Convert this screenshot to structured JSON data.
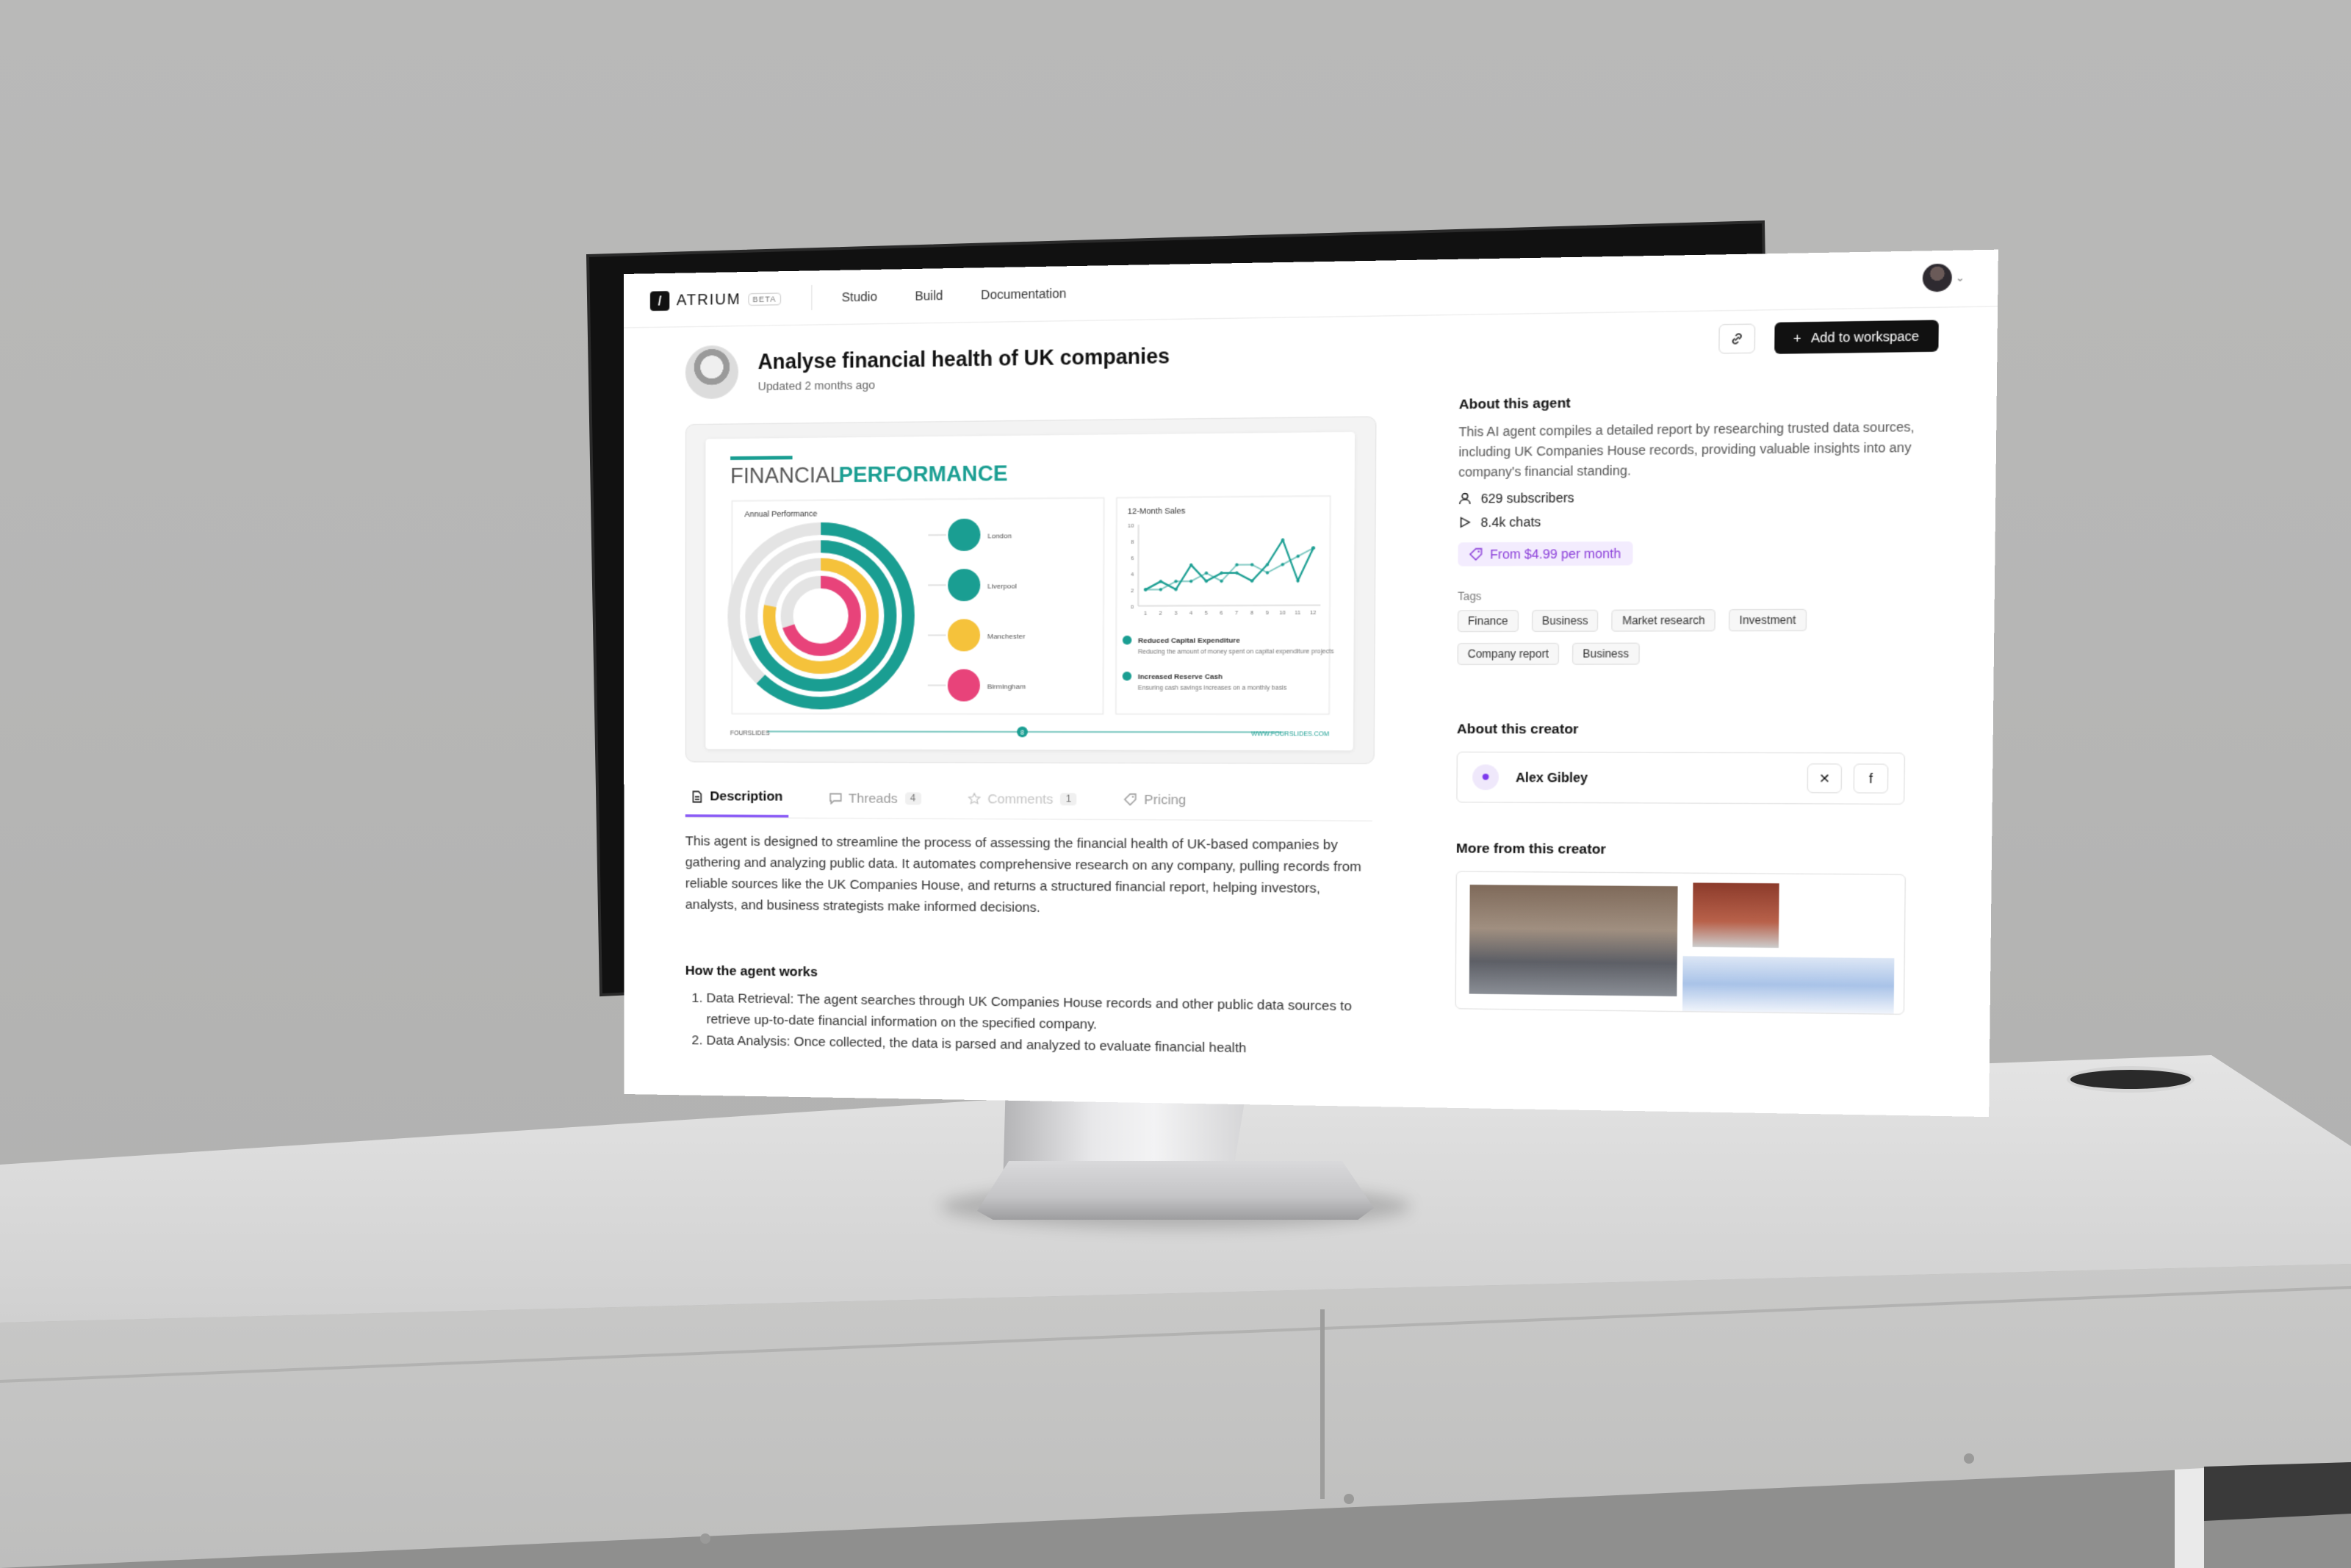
{
  "app": {
    "name": "ATRIUM",
    "badge": "BETA"
  },
  "nav": {
    "links": [
      "Studio",
      "Build",
      "Documentation"
    ]
  },
  "agent": {
    "title": "Analyse financial health of UK companies",
    "updated": "Updated 2 months ago",
    "add_button": "Add to workspace"
  },
  "infographic": {
    "title_a": "FINANCIAL",
    "title_b": "PERFORMANCE",
    "panel_left": "Annual Performance",
    "cities": [
      "London",
      "Liverpool",
      "Manchester",
      "Birmingham"
    ],
    "panel_right": "12-Month Sales",
    "y_ticks": [
      "10",
      "8",
      "6",
      "4",
      "2",
      "0"
    ],
    "x_ticks": [
      "1",
      "2",
      "3",
      "4",
      "5",
      "6",
      "7",
      "8",
      "9",
      "10",
      "11",
      "12"
    ],
    "check1_title": "Reduced Capital Expenditure",
    "check1_body": "Reducing the amount of money spent on capital expenditure projects",
    "check2_title": "Increased Reserve Cash",
    "check2_body": "Ensuring cash savings increases on a monthly basis",
    "footer_left": "FOURSLIDES",
    "footer_right": "WWW.FOURSLIDES.COM",
    "page": "8",
    "colors": {
      "teal": "#1a9e92",
      "yellow": "#f5c23b",
      "pink": "#e8437a",
      "grey": "#e4e4e4"
    },
    "sales_series": [
      {
        "name": "",
        "values": [
          2,
          3,
          2,
          5,
          3,
          4,
          4,
          3,
          5,
          8,
          3,
          7
        ]
      },
      {
        "name": "",
        "values": [
          2,
          2,
          3,
          3,
          4,
          3,
          5,
          5,
          4,
          5,
          6,
          7
        ]
      }
    ]
  },
  "tabs": [
    {
      "label": "Description",
      "count": "",
      "icon": "document-icon"
    },
    {
      "label": "Threads",
      "count": "4",
      "icon": "chat-icon"
    },
    {
      "label": "Comments",
      "count": "1",
      "icon": "star-icon"
    },
    {
      "label": "Pricing",
      "count": "",
      "icon": "tag-icon"
    }
  ],
  "description": "This agent is designed to streamline the process of assessing the financial health of UK-based companies by gathering and analyzing public data. It automates comprehensive research on any company, pulling records from reliable sources like the UK Companies House, and returns a structured financial report, helping investors, analysts, and business strategists make informed decisions.",
  "how": {
    "title": "How the agent works",
    "steps": [
      "Data Retrieval: The agent searches through UK Companies House records and other public data sources to retrieve up-to-date financial information on the specified company.",
      "Data Analysis: Once collected, the data is parsed and analyzed to evaluate financial health"
    ]
  },
  "about": {
    "title": "About this agent",
    "text": "This AI agent compiles a detailed report by researching trusted data sources, including UK Companies House records, providing valuable insights into any company's financial standing.",
    "subscribers": "629 subscribers",
    "chats": "8.4k chats",
    "price": "From $4.99 per month",
    "tags_label": "Tags",
    "tags": [
      "Finance",
      "Business",
      "Market research",
      "Investment",
      "Company report",
      "Business"
    ]
  },
  "creator": {
    "title": "About this creator",
    "name": "Alex Gibley",
    "more_title": "More from this creator"
  },
  "theme": {
    "accent": "#8b5cf6",
    "price_text": "#8b3fd9",
    "button_bg": "#111111"
  }
}
